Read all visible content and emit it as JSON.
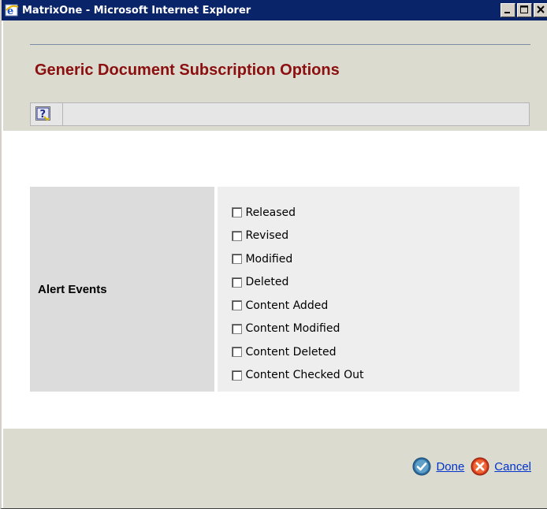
{
  "window": {
    "title": "MatrixOne - Microsoft Internet Explorer"
  },
  "page": {
    "title": "Generic Document Subscription Options"
  },
  "toolbar": {
    "help_icon": "help-icon"
  },
  "form": {
    "label": "Alert Events",
    "options": [
      {
        "label": "Released",
        "checked": false
      },
      {
        "label": "Revised",
        "checked": false
      },
      {
        "label": "Modified",
        "checked": false
      },
      {
        "label": "Deleted",
        "checked": false
      },
      {
        "label": "Content Added",
        "checked": false
      },
      {
        "label": "Content Modified",
        "checked": false
      },
      {
        "label": "Content Deleted",
        "checked": false
      },
      {
        "label": "Content Checked Out",
        "checked": false
      }
    ]
  },
  "actions": {
    "done_label": "Done",
    "cancel_label": "Cancel"
  },
  "colors": {
    "title_text": "#8b0f0f",
    "link": "#0033cc",
    "titlebar": "#0a246a",
    "band": "#dcdbd0"
  }
}
